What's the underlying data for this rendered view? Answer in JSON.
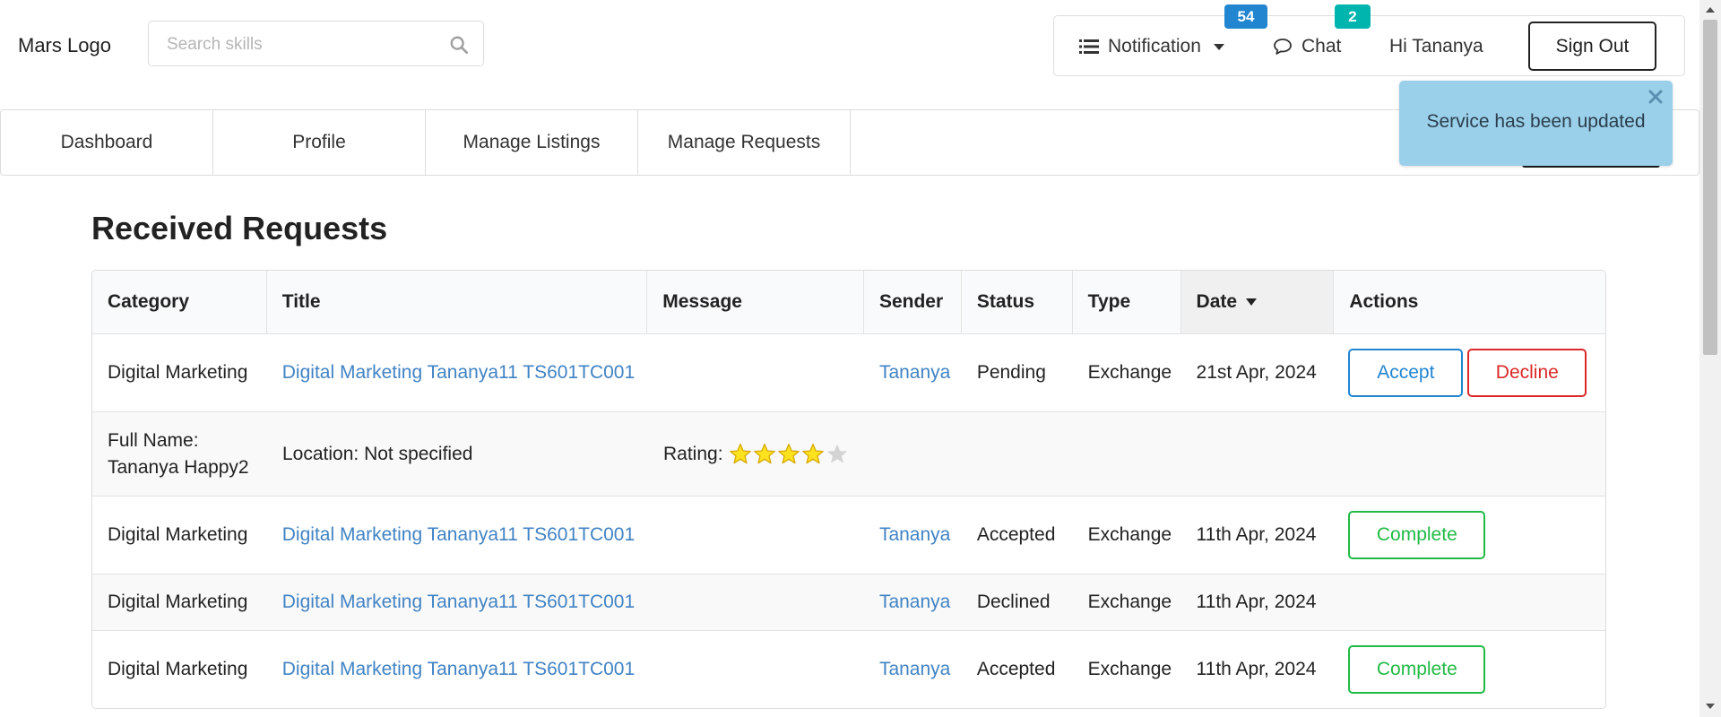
{
  "header": {
    "logo": "Mars Logo",
    "search": {
      "placeholder": "Search skills",
      "value": ""
    },
    "notification": {
      "label": "Notification",
      "count": "54"
    },
    "chat": {
      "label": "Chat",
      "count": "2"
    },
    "greeting": "Hi Tananya",
    "signout_label": "Sign Out"
  },
  "tabs": [
    {
      "label": "Dashboard"
    },
    {
      "label": "Profile"
    },
    {
      "label": "Manage Listings"
    },
    {
      "label": "Manage Requests"
    }
  ],
  "toast": {
    "message": "Service has been updated"
  },
  "page": {
    "title": "Received Requests"
  },
  "table": {
    "columns": [
      "Category",
      "Title",
      "Message",
      "Sender",
      "Status",
      "Type",
      "Date",
      "Actions"
    ],
    "sorted_column": "Date",
    "rows": [
      {
        "category": "Digital Marketing",
        "title": "Digital Marketing Tananya11 TS601TC001",
        "message": "",
        "sender": "Tananya",
        "status": "Pending",
        "type": "Exchange",
        "date": "21st Apr, 2024",
        "actions": [
          "Accept",
          "Decline"
        ]
      },
      {
        "category": "Digital Marketing",
        "title": "Digital Marketing Tananya11 TS601TC001",
        "message": "",
        "sender": "Tananya",
        "status": "Accepted",
        "type": "Exchange",
        "date": "11th Apr, 2024",
        "actions": [
          "Complete"
        ]
      },
      {
        "category": "Digital Marketing",
        "title": "Digital Marketing Tananya11 TS601TC001",
        "message": "",
        "sender": "Tananya",
        "status": "Declined",
        "type": "Exchange",
        "date": "11th Apr, 2024",
        "actions": []
      },
      {
        "category": "Digital Marketing",
        "title": "Digital Marketing Tananya11 TS601TC001",
        "message": "",
        "sender": "Tananya",
        "status": "Accepted",
        "type": "Exchange",
        "date": "11th Apr, 2024",
        "actions": [
          "Complete"
        ]
      }
    ],
    "detail": {
      "full_name_label": "Full Name:",
      "full_name": "Tananya Happy2",
      "location": "Location: Not specified",
      "rating_label": "Rating:",
      "rating": 4,
      "rating_max": 5
    }
  },
  "colors": {
    "link": "#4183c4",
    "accept": "#2185d0",
    "decline": "#db2828",
    "complete": "#21ba45",
    "notification_badge": "#2185d0",
    "chat_badge": "#00b5ad",
    "toast_bg": "#9bd0ea",
    "star_filled": "#ffe21f",
    "star_empty": "#d4d4d4"
  },
  "icons": [
    "search-icon",
    "list-icon",
    "chevron-down-icon",
    "chat-bubble-icon",
    "close-icon",
    "sort-down-icon",
    "star-icon"
  ]
}
